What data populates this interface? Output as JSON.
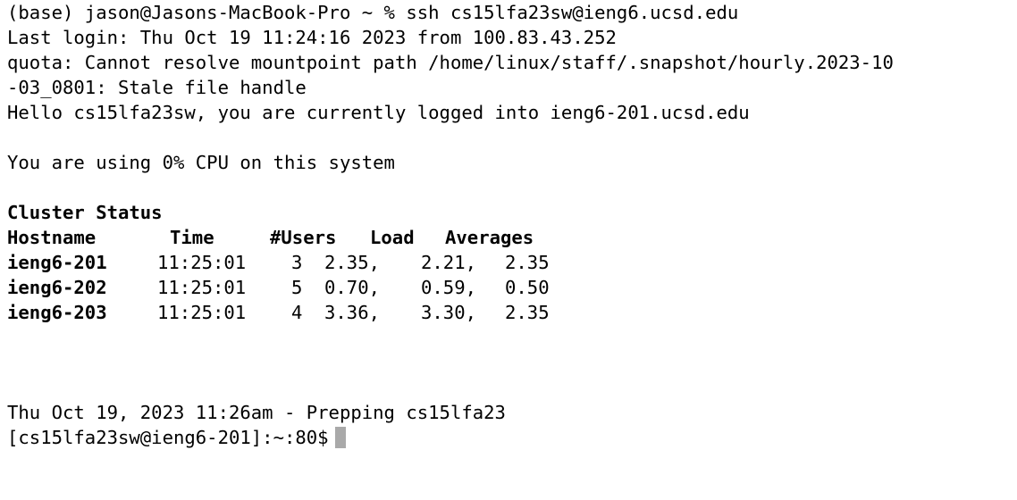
{
  "prompt_line": "(base) jason@Jasons-MacBook-Pro ~ % ssh cs15lfa23sw@ieng6.ucsd.edu",
  "last_login": "Last login: Thu Oct 19 11:24:16 2023 from 100.83.43.252",
  "quota_line_1": "quota: Cannot resolve mountpoint path /home/linux/staff/.snapshot/hourly.2023-10",
  "quota_line_2": "-03_0801: Stale file handle",
  "hello_line": "Hello cs15lfa23sw, you are currently logged into ieng6-201.ucsd.edu",
  "cpu_line": "You are using 0% CPU on this system",
  "cluster": {
    "title": "Cluster Status",
    "headers": {
      "hostname": "Hostname",
      "time": "Time",
      "users": "#Users",
      "load": "Load",
      "averages": "Averages"
    },
    "rows": [
      {
        "host": "ieng6-201",
        "time": "11:25:01",
        "users": "3",
        "l1": "2.35,",
        "l2": "2.21,",
        "l3": "2.35"
      },
      {
        "host": "ieng6-202",
        "time": "11:25:01",
        "users": "5",
        "l1": "0.70,",
        "l2": "0.59,",
        "l3": "0.50"
      },
      {
        "host": "ieng6-203",
        "time": "11:25:01",
        "users": "4",
        "l1": "3.36,",
        "l2": "3.30,",
        "l3": "2.35"
      }
    ]
  },
  "prep_line": "Thu Oct 19, 2023 11:26am - Prepping cs15lfa23",
  "shell_prompt": "[cs15lfa23sw@ieng6-201]:~:80$"
}
